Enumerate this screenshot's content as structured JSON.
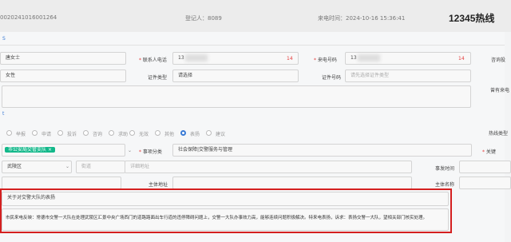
{
  "header": {
    "ticket_no": "0020241016001264",
    "registrar_label": "登记人：8089",
    "time_label": "来电时间：2024-10-16 15:36:41",
    "title": "12345热线"
  },
  "tab": {
    "label": "S"
  },
  "row1": {
    "name_value": "唐女士",
    "contact_label": "* 联系人电话",
    "contact_value": "13",
    "contact_count": "14",
    "caller_label": "* 来电号码",
    "caller_value": "13",
    "caller_count": "14",
    "right_label": "咨询投"
  },
  "row2": {
    "gender_value": "女性",
    "id_type_label": "证件类型",
    "id_type_value": "请选择",
    "id_no_label": "证件号码",
    "id_no_placeholder": "请先选择证件类型",
    "right_label": "曾有来电"
  },
  "side_mark": "t",
  "radios": [
    "举报",
    "申请",
    "投诉",
    "咨询",
    "求助",
    "无效",
    "其他",
    "表扬",
    "建议"
  ],
  "radio_checked_index": 7,
  "right_labels": {
    "hotline_type": "热线类型",
    "keyword": "* 关键"
  },
  "dept": {
    "tag_text": "市公安局交管支队",
    "tag_close": "×",
    "category_label": "* 事项分类",
    "category_value": "社会保障|交警服务与管理"
  },
  "district": {
    "value": "武陵区",
    "street_placeholder": "街道",
    "address_placeholder": "详细地址",
    "event_time_label": "事发时间"
  },
  "subject": {
    "label": "主体地址",
    "label2": "主体名称"
  },
  "content": {
    "title": "关于对交警大队的表扬",
    "body": "市民来电反映：常德市交警一大队在处理武陵区汇景中央广场西门的道路路面出车行道的违停障碍问题上，交警一大队办事效力高，能够连续问题积极解决。特来电表扬，诉求：表扬交警一大队，望相关部门核实处理。"
  },
  "colors": {
    "accent": "#3a7bd5",
    "tag_green": "#12b88a",
    "alert_red": "#d42020",
    "count_red": "#e43b3b"
  }
}
